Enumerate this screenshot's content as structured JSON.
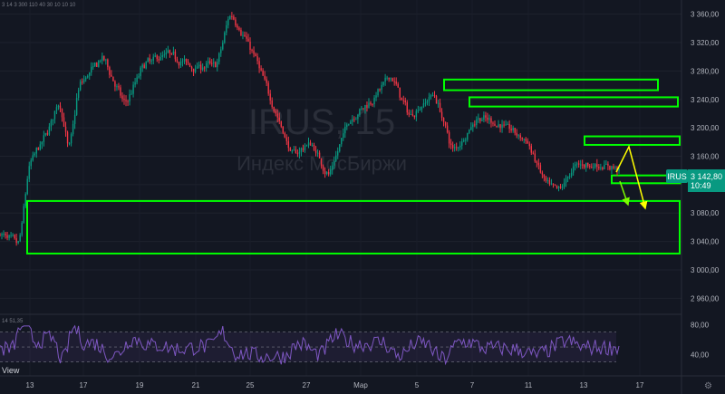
{
  "header": {
    "ohlc_text": "3 14 3 300 110 40 30 10 10 10"
  },
  "watermark": {
    "symbol": "IRUS, 15",
    "name": "Индекс МосБиржи"
  },
  "price_tag": {
    "symbol": "IRUS",
    "price": "3 142,80",
    "countdown": "10:49",
    "color": "#089981"
  },
  "rsi_header": "14 51,35",
  "brand_text": "View",
  "colors": {
    "up": "#089981",
    "down": "#f23645",
    "zone": "#00ff00",
    "arrow": "#ffff00",
    "rsi": "#7e57c2"
  },
  "y_axis_ticks": [
    "3 360,00",
    "3 320,00",
    "3 280,00",
    "3 240,00",
    "3 200,00",
    "3 160,00",
    "3 120,00",
    "3 080,00",
    "3 040,00",
    "3 000,00",
    "2 960,00"
  ],
  "rsi_axis_ticks": [
    "80,00",
    "40,00"
  ],
  "x_axis_ticks": [
    "13",
    "17",
    "19",
    "21",
    "25",
    "27",
    "Мар",
    "5",
    "7",
    "11",
    "13",
    "17"
  ],
  "chart_data": {
    "type": "candlestick",
    "title": "IRUS, 15",
    "subtitle": "Индекс МосБиржи",
    "ylim": [
      2940,
      3380
    ],
    "y_ticks": [
      3360,
      3320,
      3280,
      3240,
      3200,
      3160,
      3120,
      3080,
      3040,
      3000,
      2960
    ],
    "x_ticks": [
      "13",
      "17",
      "19",
      "21",
      "25",
      "27",
      "Мар",
      "5",
      "7",
      "11",
      "13",
      "17"
    ],
    "last_price": 3142.8,
    "trend": [
      {
        "t": 0,
        "p": 3050
      },
      {
        "t": 0.03,
        "p": 3035
      },
      {
        "t": 0.045,
        "p": 3150
      },
      {
        "t": 0.07,
        "p": 3185
      },
      {
        "t": 0.095,
        "p": 3240
      },
      {
        "t": 0.11,
        "p": 3160
      },
      {
        "t": 0.125,
        "p": 3260
      },
      {
        "t": 0.165,
        "p": 3300
      },
      {
        "t": 0.2,
        "p": 3230
      },
      {
        "t": 0.23,
        "p": 3290
      },
      {
        "t": 0.27,
        "p": 3305
      },
      {
        "t": 0.31,
        "p": 3285
      },
      {
        "t": 0.35,
        "p": 3290
      },
      {
        "t": 0.37,
        "p": 3365
      },
      {
        "t": 0.41,
        "p": 3300
      },
      {
        "t": 0.44,
        "p": 3230
      },
      {
        "t": 0.47,
        "p": 3160
      },
      {
        "t": 0.5,
        "p": 3180
      },
      {
        "t": 0.53,
        "p": 3130
      },
      {
        "t": 0.56,
        "p": 3210
      },
      {
        "t": 0.6,
        "p": 3240
      },
      {
        "t": 0.63,
        "p": 3275
      },
      {
        "t": 0.66,
        "p": 3215
      },
      {
        "t": 0.7,
        "p": 3250
      },
      {
        "t": 0.73,
        "p": 3165
      },
      {
        "t": 0.77,
        "p": 3215
      },
      {
        "t": 0.82,
        "p": 3200
      },
      {
        "t": 0.85,
        "p": 3180
      },
      {
        "t": 0.88,
        "p": 3120
      },
      {
        "t": 0.9,
        "p": 3110
      },
      {
        "t": 0.93,
        "p": 3150
      },
      {
        "t": 1,
        "p": 3143
      }
    ],
    "zones": [
      {
        "p_top": 3268,
        "p_bottom": 3253
      },
      {
        "p_top": 3243,
        "p_bottom": 3230
      },
      {
        "p_top": 3188,
        "p_bottom": 3176
      },
      {
        "p_top": 3133,
        "p_bottom": 3122
      },
      {
        "p_top": 3097,
        "p_bottom": 3023
      }
    ],
    "rsi": {
      "period": 14,
      "value": 51.35,
      "upper": 70,
      "lower": 30,
      "ylim": [
        15,
        90
      ]
    }
  }
}
